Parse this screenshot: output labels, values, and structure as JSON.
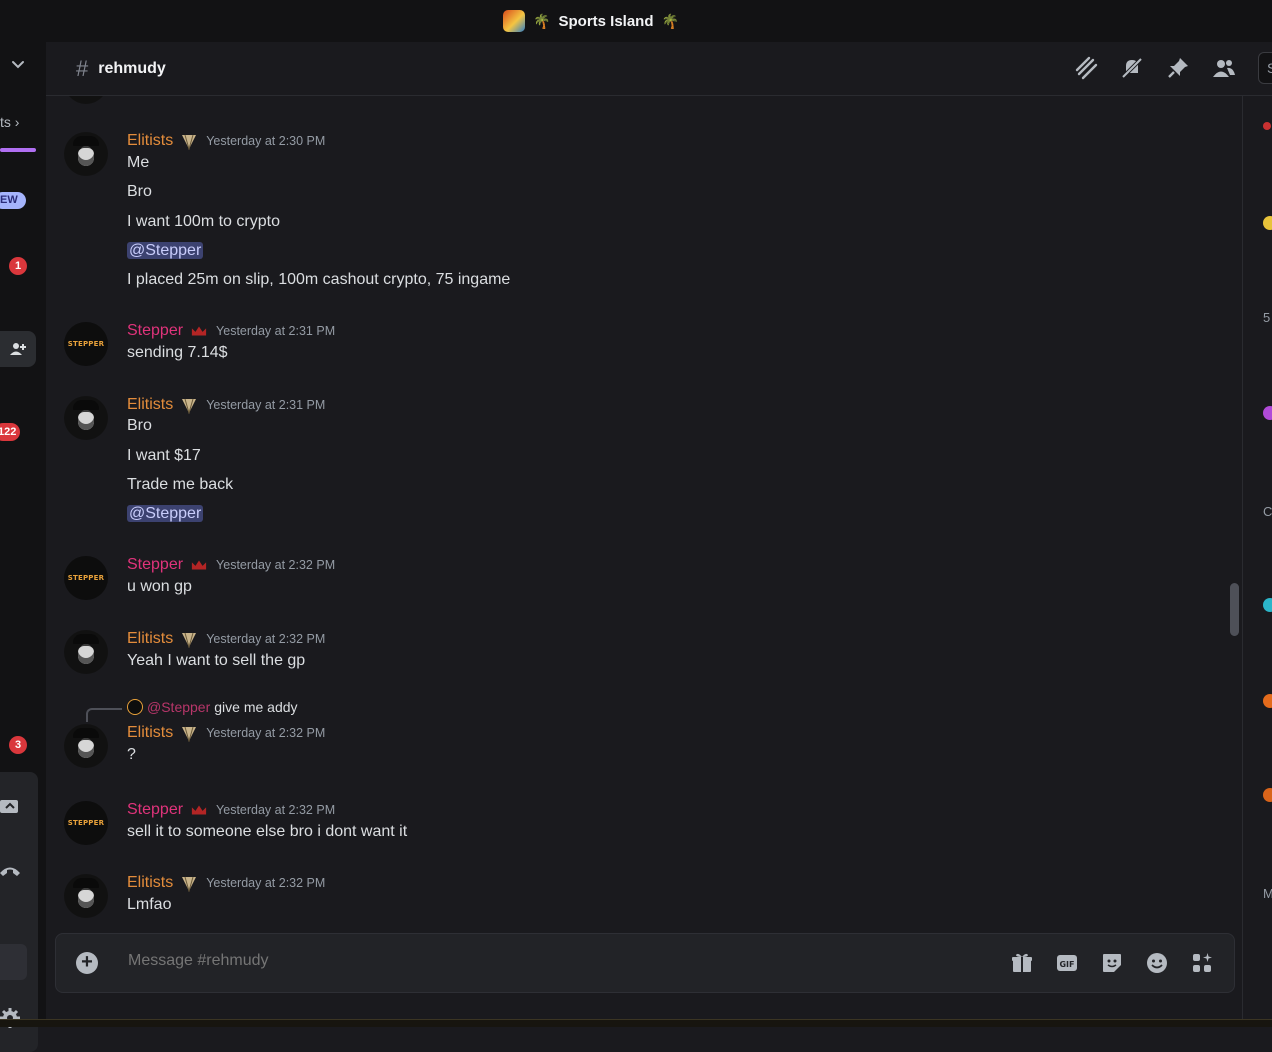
{
  "window": {
    "title": "Sports Island"
  },
  "channel": {
    "name": "rehmudy",
    "composer_placeholder": "Message #rehmudy"
  },
  "sidebar": {
    "partial_label": "ts",
    "new_badge": "EW",
    "badges": [
      "1",
      "122",
      "3"
    ]
  },
  "members_strip_letters": [
    "5",
    "C",
    "M"
  ],
  "messages": [
    {
      "author": "Elitists",
      "role": "elit",
      "timestamp": "Yesterday at 2:30 PM",
      "lines": [
        {
          "text": "Me"
        },
        {
          "text": "Bro"
        },
        {
          "text": "I want 100m to crypto"
        },
        {
          "text": "@Stepper",
          "mention": true
        },
        {
          "text": "I placed 25m on slip, 100m cashout crypto, 75 ingame"
        }
      ]
    },
    {
      "author": "Stepper",
      "role": "step",
      "timestamp": "Yesterday at 2:31 PM",
      "lines": [
        {
          "text": "sending 7.14$"
        }
      ]
    },
    {
      "author": "Elitists",
      "role": "elit",
      "timestamp": "Yesterday at 2:31 PM",
      "lines": [
        {
          "text": "Bro"
        },
        {
          "text": "I want $17"
        },
        {
          "text": "Trade me back"
        },
        {
          "text": "@Stepper",
          "mention": true
        }
      ]
    },
    {
      "author": "Stepper",
      "role": "step",
      "timestamp": "Yesterday at 2:32 PM",
      "lines": [
        {
          "text": "u won gp"
        }
      ]
    },
    {
      "author": "Elitists",
      "role": "elit",
      "timestamp": "Yesterday at 2:32 PM",
      "lines": [
        {
          "text": "Yeah I want to sell the gp"
        }
      ]
    },
    {
      "author": "Elitists",
      "role": "elit",
      "timestamp": "Yesterday at 2:32 PM",
      "reply": {
        "name": "@Stepper",
        "text": "give me addy"
      },
      "lines": [
        {
          "text": "?"
        }
      ]
    },
    {
      "author": "Stepper",
      "role": "step",
      "timestamp": "Yesterday at 2:32 PM",
      "lines": [
        {
          "text": "sell it to someone else bro i dont want it"
        }
      ]
    },
    {
      "author": "Elitists",
      "role": "elit",
      "timestamp": "Yesterday at 2:32 PM",
      "lines": [
        {
          "text": "Lmfao"
        }
      ]
    }
  ],
  "icons": {
    "header": [
      "threads-icon",
      "mute-bell-icon",
      "pin-icon",
      "member-list-icon"
    ],
    "composer": [
      "gift-icon",
      "gif-icon",
      "sticker-icon",
      "emoji-icon",
      "apps-icon"
    ]
  },
  "colors": {
    "elitists_name": "#e38c3b",
    "stepper_name": "#e0337b",
    "mention_bg": "#3c4270",
    "background": "#1a1a1e"
  }
}
